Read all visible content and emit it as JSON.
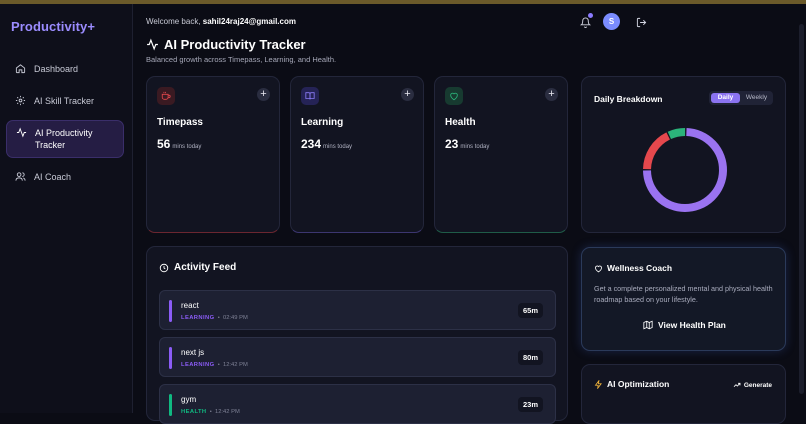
{
  "brand": "Productivity+",
  "header": {
    "welcome_prefix": "Welcome back,",
    "email": "sahil24raj24@gmail.com",
    "avatar_initial": "S"
  },
  "sidebar": {
    "items": [
      {
        "label": "Dashboard",
        "icon": "home-icon"
      },
      {
        "label": "AI Skill Tracker",
        "icon": "gear-icon"
      },
      {
        "label": "AI Productivity Tracker",
        "icon": "activity-icon",
        "active": true
      },
      {
        "label": "AI Coach",
        "icon": "users-icon"
      }
    ]
  },
  "page": {
    "title": "AI Productivity Tracker",
    "subtitle": "Balanced growth across Timepass, Learning, and Health."
  },
  "stats": [
    {
      "name": "Timepass",
      "value": "56",
      "unit": "mins today",
      "color": "#e5484d"
    },
    {
      "name": "Learning",
      "value": "234",
      "unit": "mins today",
      "color": "#7b6cf6"
    },
    {
      "name": "Health",
      "value": "23",
      "unit": "mins today",
      "color": "#2bb37a"
    }
  ],
  "breakdown": {
    "title": "Daily Breakdown",
    "toggle": [
      "Daily",
      "Weekly"
    ],
    "selected": "Daily"
  },
  "chart_data": {
    "type": "pie",
    "categories": [
      "Learning",
      "Timepass",
      "Health"
    ],
    "values": [
      234,
      56,
      23
    ],
    "colors": [
      "#9a73f0",
      "#e5484d",
      "#2bb37a"
    ],
    "donut": true
  },
  "feed": {
    "title": "Activity Feed",
    "items": [
      {
        "name": "react",
        "category": "LEARNING",
        "time": "02:49 PM",
        "duration": "65m",
        "color": "#8b5cf6"
      },
      {
        "name": "next js",
        "category": "LEARNING",
        "time": "12:42 PM",
        "duration": "80m",
        "color": "#8b5cf6"
      },
      {
        "name": "gym",
        "category": "HEALTH",
        "time": "12:42 PM",
        "duration": "23m",
        "color": "#10b981"
      }
    ]
  },
  "wellness": {
    "title": "Wellness Coach",
    "description": "Get a complete personalized mental and physical health roadmap based on your lifestyle.",
    "button": "View Health Plan"
  },
  "ai_optimization": {
    "title": "AI Optimization",
    "generate": "Generate"
  }
}
